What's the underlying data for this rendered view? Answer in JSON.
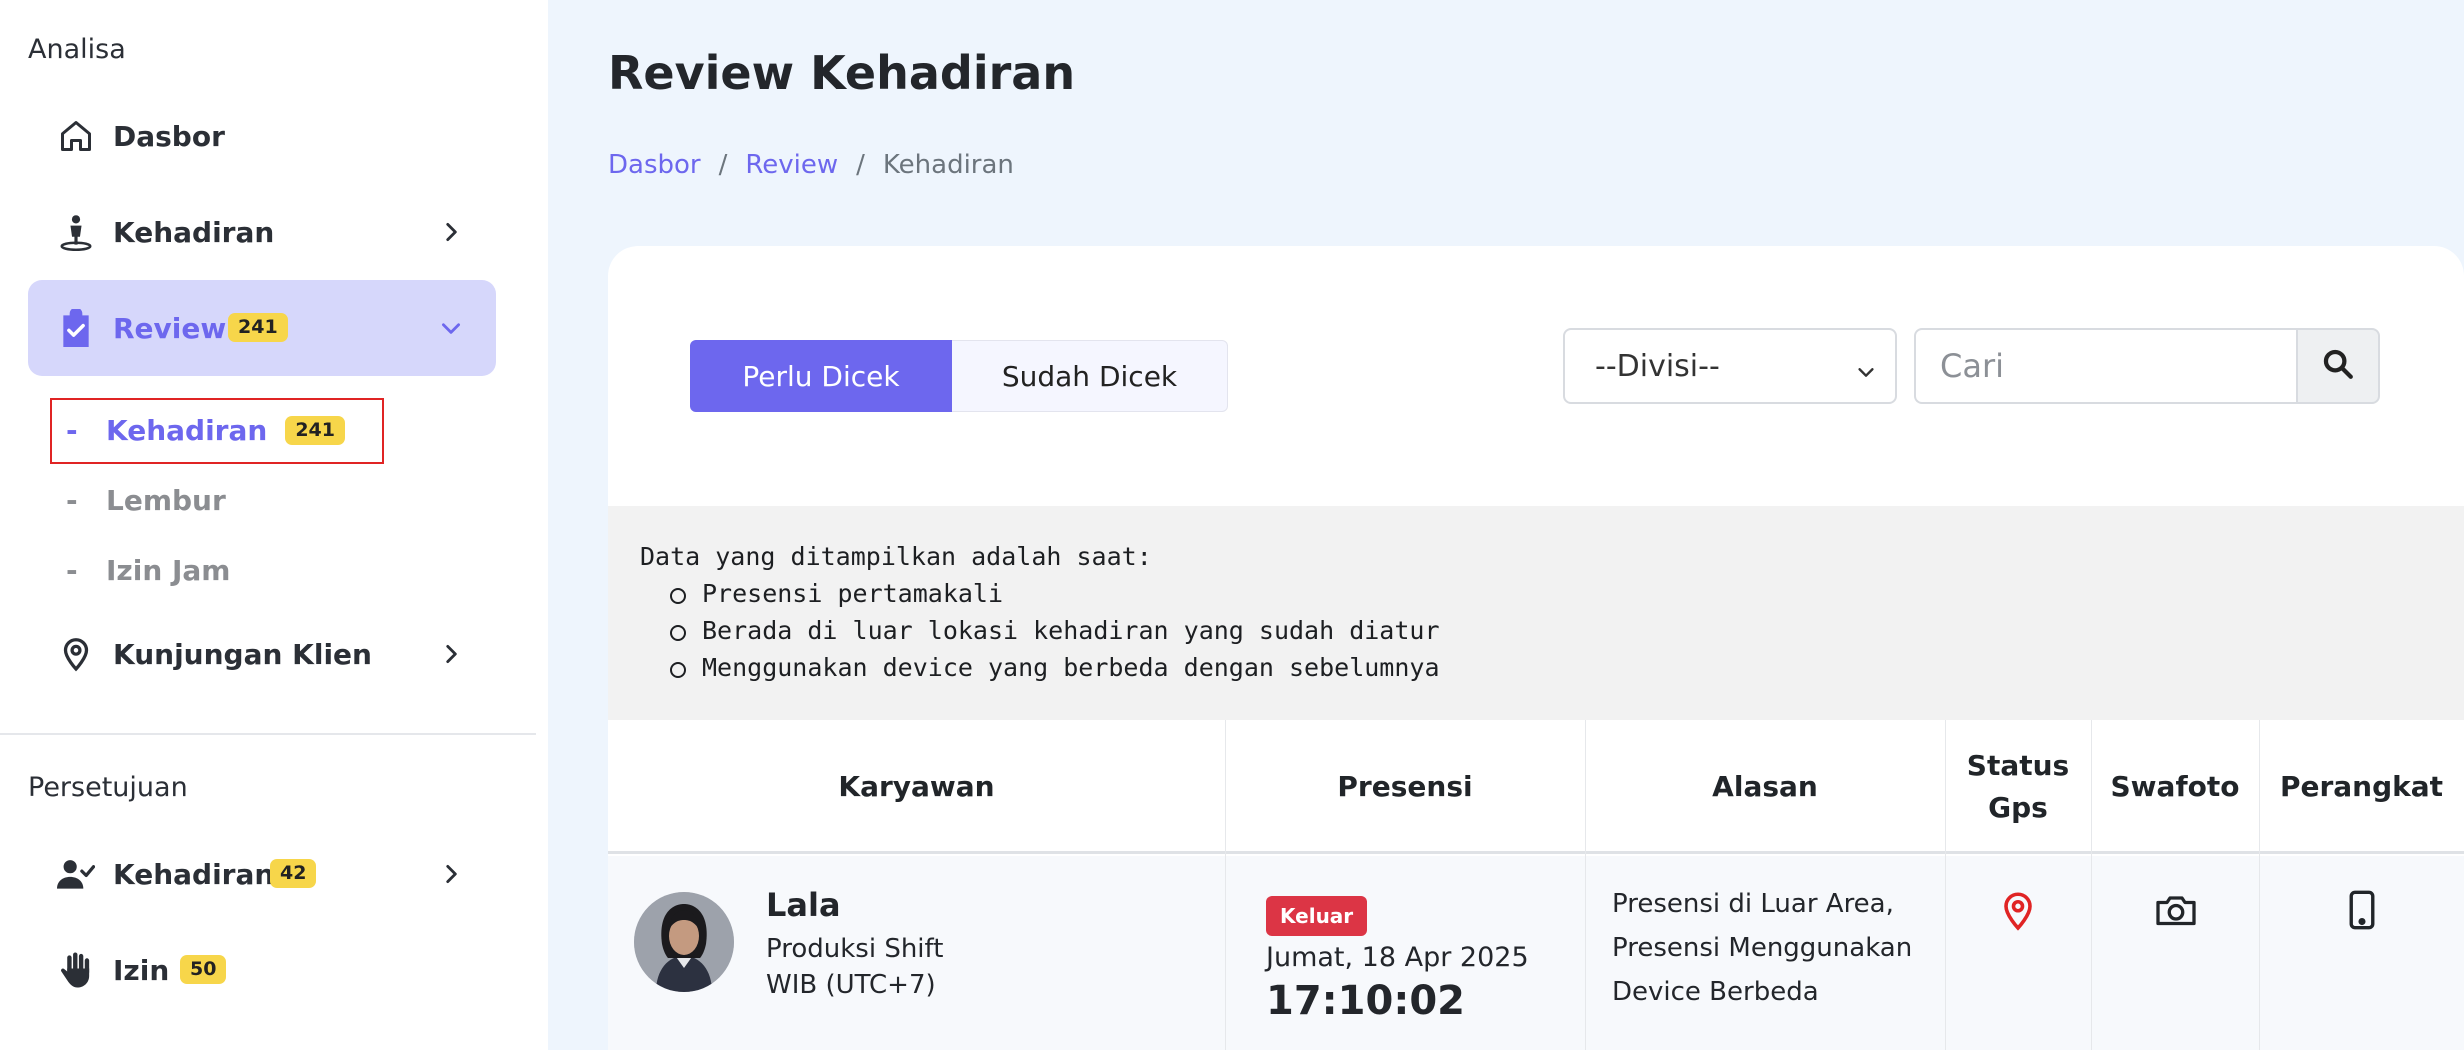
{
  "sidebar": {
    "section_analisa": "Analisa",
    "items": [
      {
        "label": "Dasbor"
      },
      {
        "label": "Kehadiran"
      },
      {
        "label": "Review",
        "badge": "241"
      },
      {
        "label": "Kunjungan Klien"
      }
    ],
    "review_sub": [
      {
        "dash": "-",
        "label": "Kehadiran",
        "badge": "241"
      },
      {
        "dash": "-",
        "label": "Lembur"
      },
      {
        "dash": "-",
        "label": "Izin Jam"
      }
    ],
    "section_persetujuan": "Persetujuan",
    "approval_items": [
      {
        "label": "Kehadiran",
        "badge": "42"
      },
      {
        "label": "Izin",
        "badge": "50"
      }
    ]
  },
  "header": {
    "title": "Review Kehadiran",
    "breadcrumb": {
      "home": "Dasbor",
      "sep": "/",
      "review": "Review",
      "current": "Kehadiran"
    }
  },
  "filters": {
    "tab_active": "Perlu Dicek",
    "tab_inactive": "Sudah Dicek",
    "division_select": "--Divisi--",
    "search_placeholder": "Cari"
  },
  "info": {
    "heading": "Data yang ditampilkan adalah saat:",
    "points": [
      "Presensi pertamakali",
      "Berada di luar lokasi kehadiran yang sudah diatur",
      "Menggunakan device yang berbeda dengan sebelumnya"
    ]
  },
  "table": {
    "columns": [
      "Karyawan",
      "Presensi",
      "Alasan",
      "Status Gps",
      "Swafoto",
      "Perangkat"
    ],
    "rows": [
      {
        "name": "Lala",
        "department": "Produksi Shift",
        "timezone": "WIB (UTC+7)",
        "status": "Keluar",
        "date": "Jumat, 18 Apr 2025",
        "time": "17:10:02",
        "reason": "Presensi di Luar Area, Presensi Menggunakan Device Berbeda"
      }
    ]
  },
  "colors": {
    "accent": "#6d67ee",
    "active_bg": "#d6d7fb",
    "badge": "#f7d64a",
    "danger": "#dc3545",
    "gps_pin": "#e02424"
  },
  "icons": {
    "dasbor": "home-icon",
    "kehadiran": "person-pin-icon",
    "review": "clipboard-check-icon",
    "kunjungan": "map-pin-icon",
    "approval_kehadiran": "user-check-icon",
    "izin": "hand-icon",
    "search": "search-icon",
    "gps": "map-pin-icon",
    "swafoto": "camera-icon",
    "perangkat": "mobile-icon"
  }
}
